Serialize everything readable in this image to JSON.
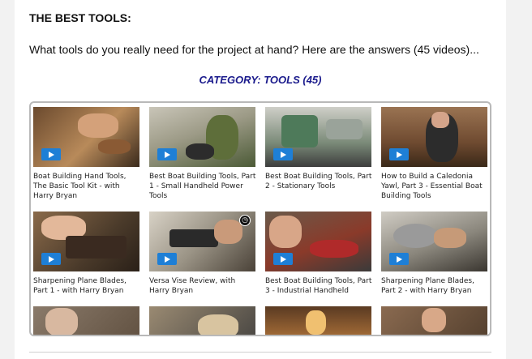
{
  "heading": "THE BEST TOOLS:",
  "intro": "What tools do you really need for the project at hand?  Here are the answers (45 videos)...",
  "category_link": "CATEGORY:  TOOLS (45)",
  "colors": {
    "category": "#1a1a8c",
    "play_button": "#1e7fd6"
  },
  "videos": [
    {
      "title": "Boat Building Hand Tools, The Basic Tool Kit - with Harry Bryan",
      "play_icon": "play-icon"
    },
    {
      "title": "Best Boat Building Tools, Part 1 - Small Handheld Power Tools",
      "play_icon": "play-icon"
    },
    {
      "title": "Best Boat Building Tools, Part 2 - Stationary Tools",
      "play_icon": "play-icon"
    },
    {
      "title": "How to Build a Caledonia Yawl, Part 3 - Essential Boat Building Tools",
      "play_icon": "play-icon"
    },
    {
      "title": "Sharpening Plane Blades, Part 1 - with Harry Bryan",
      "play_icon": "play-icon"
    },
    {
      "title": "Versa Vise Review, with Harry Bryan",
      "play_icon": "play-icon",
      "extra_icon": "clock-icon"
    },
    {
      "title": "Best Boat Building Tools, Part 3 - Industrial Handheld",
      "play_icon": "play-icon"
    },
    {
      "title": "Sharpening Plane Blades, Part 2 - with Harry Bryan",
      "play_icon": "play-icon"
    },
    {
      "title": "",
      "play_icon": ""
    },
    {
      "title": "",
      "play_icon": ""
    },
    {
      "title": "",
      "play_icon": ""
    },
    {
      "title": "",
      "play_icon": ""
    }
  ]
}
